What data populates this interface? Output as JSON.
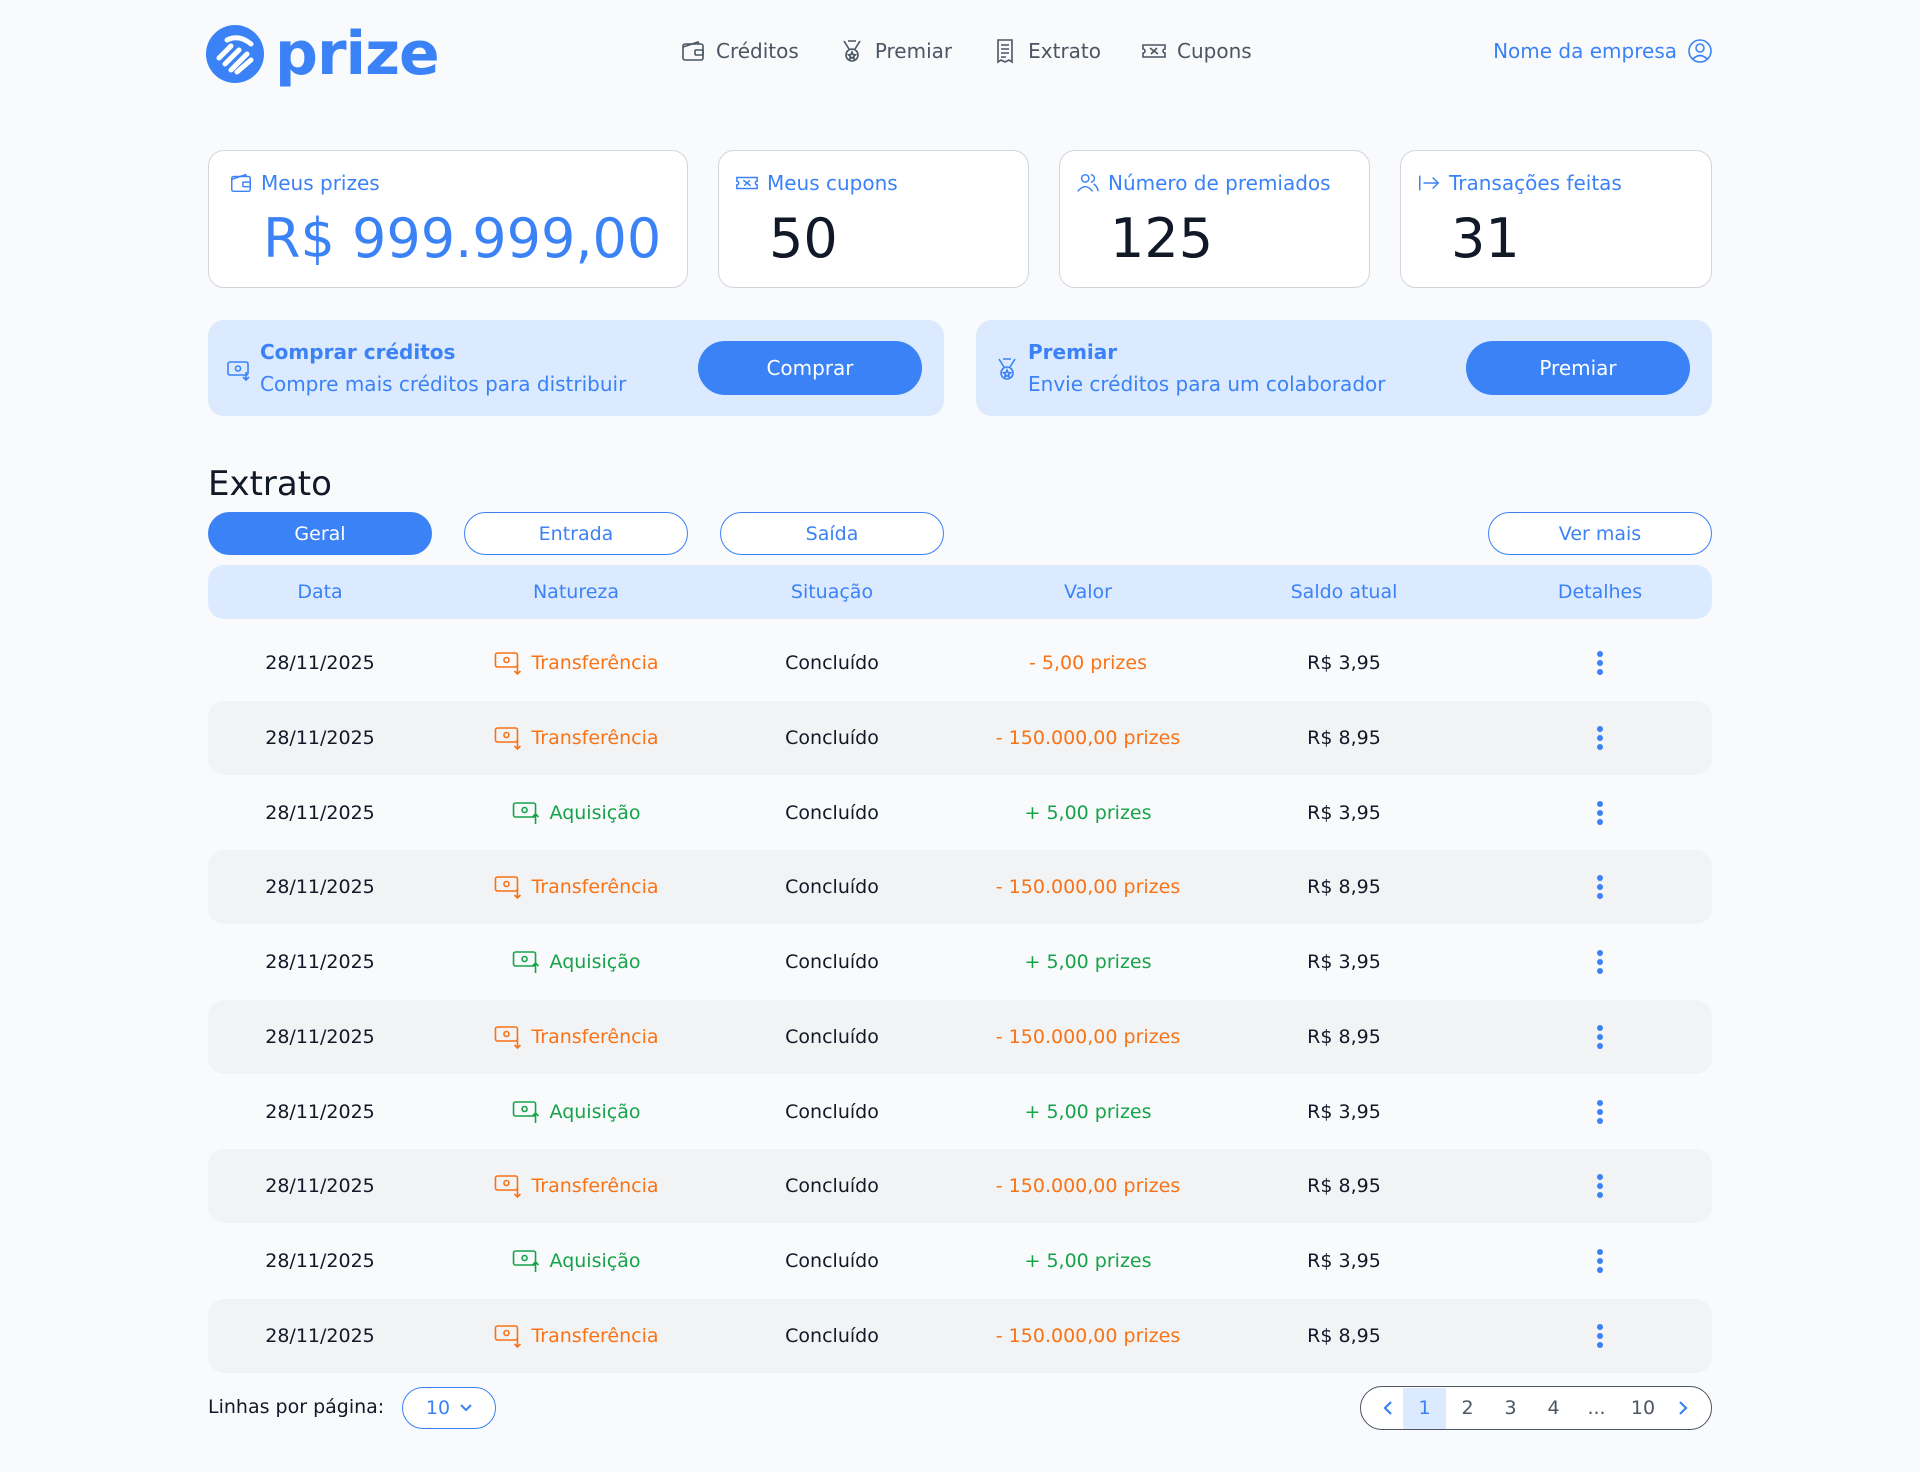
{
  "brand": {
    "name": "prize",
    "color": "#3b82f6"
  },
  "nav": [
    {
      "label": "Créditos",
      "icon": "wallet-icon"
    },
    {
      "label": "Premiar",
      "icon": "medal-icon"
    },
    {
      "label": "Extrato",
      "icon": "receipt-icon"
    },
    {
      "label": "Cupons",
      "icon": "ticket-icon"
    }
  ],
  "account": {
    "label": "Nome da empresa",
    "icon": "user-circle-icon"
  },
  "stats": {
    "prizes": {
      "label": "Meus prizes",
      "value": "R$ 999.999,00",
      "icon": "wallet-icon"
    },
    "coupons": {
      "label": "Meus cupons",
      "value": "50",
      "icon": "ticket-icon"
    },
    "awarded": {
      "label": "Número de premiados",
      "value": "125",
      "icon": "users-icon"
    },
    "transactions": {
      "label": "Transações feitas",
      "value": "31",
      "icon": "arrow-right-icon"
    }
  },
  "actions": {
    "buy": {
      "title": "Comprar créditos",
      "subtitle": "Compre mais créditos para distribuir",
      "button": "Comprar",
      "icon": "money-icon"
    },
    "award": {
      "title": "Premiar",
      "subtitle": "Envie créditos para um colaborador",
      "button": "Premiar",
      "icon": "medal-icon"
    }
  },
  "extrato": {
    "title": "Extrato",
    "filters": [
      "Geral",
      "Entrada",
      "Saída"
    ],
    "active_filter": "Geral",
    "more": "Ver mais",
    "columns": [
      "Data",
      "Natureza",
      "Situação",
      "Valor",
      "Saldo atual",
      "Detalhes"
    ],
    "rows": [
      {
        "date": "28/11/2025",
        "nature": "Transferência",
        "type": "out",
        "status": "Concluído",
        "value": "- 5,00 prizes",
        "balance": "R$ 3,95"
      },
      {
        "date": "28/11/2025",
        "nature": "Transferência",
        "type": "out",
        "status": "Concluído",
        "value": "- 150.000,00 prizes",
        "balance": "R$ 8,95"
      },
      {
        "date": "28/11/2025",
        "nature": "Aquisição",
        "type": "in",
        "status": "Concluído",
        "value": "+ 5,00 prizes",
        "balance": "R$ 3,95"
      },
      {
        "date": "28/11/2025",
        "nature": "Transferência",
        "type": "out",
        "status": "Concluído",
        "value": "- 150.000,00 prizes",
        "balance": "R$ 8,95"
      },
      {
        "date": "28/11/2025",
        "nature": "Aquisição",
        "type": "in",
        "status": "Concluído",
        "value": "+ 5,00 prizes",
        "balance": "R$ 3,95"
      },
      {
        "date": "28/11/2025",
        "nature": "Transferência",
        "type": "out",
        "status": "Concluído",
        "value": "- 150.000,00 prizes",
        "balance": "R$ 8,95"
      },
      {
        "date": "28/11/2025",
        "nature": "Aquisição",
        "type": "in",
        "status": "Concluído",
        "value": "+ 5,00 prizes",
        "balance": "R$ 3,95"
      },
      {
        "date": "28/11/2025",
        "nature": "Transferência",
        "type": "out",
        "status": "Concluído",
        "value": "- 150.000,00 prizes",
        "balance": "R$ 8,95"
      },
      {
        "date": "28/11/2025",
        "nature": "Aquisição",
        "type": "in",
        "status": "Concluído",
        "value": "+ 5,00 prizes",
        "balance": "R$ 3,95"
      },
      {
        "date": "28/11/2025",
        "nature": "Transferência",
        "type": "out",
        "status": "Concluído",
        "value": "- 150.000,00 prizes",
        "balance": "R$ 8,95"
      }
    ]
  },
  "pagination": {
    "rows_label": "Linhas por página:",
    "rows_value": "10",
    "pages": [
      "1",
      "2",
      "3",
      "4",
      "...",
      "10"
    ],
    "current": "1"
  },
  "colors": {
    "accent": "#3b82f6",
    "light_accent": "#dbeafe",
    "outflow": "#f97316",
    "inflow": "#16a34a"
  }
}
